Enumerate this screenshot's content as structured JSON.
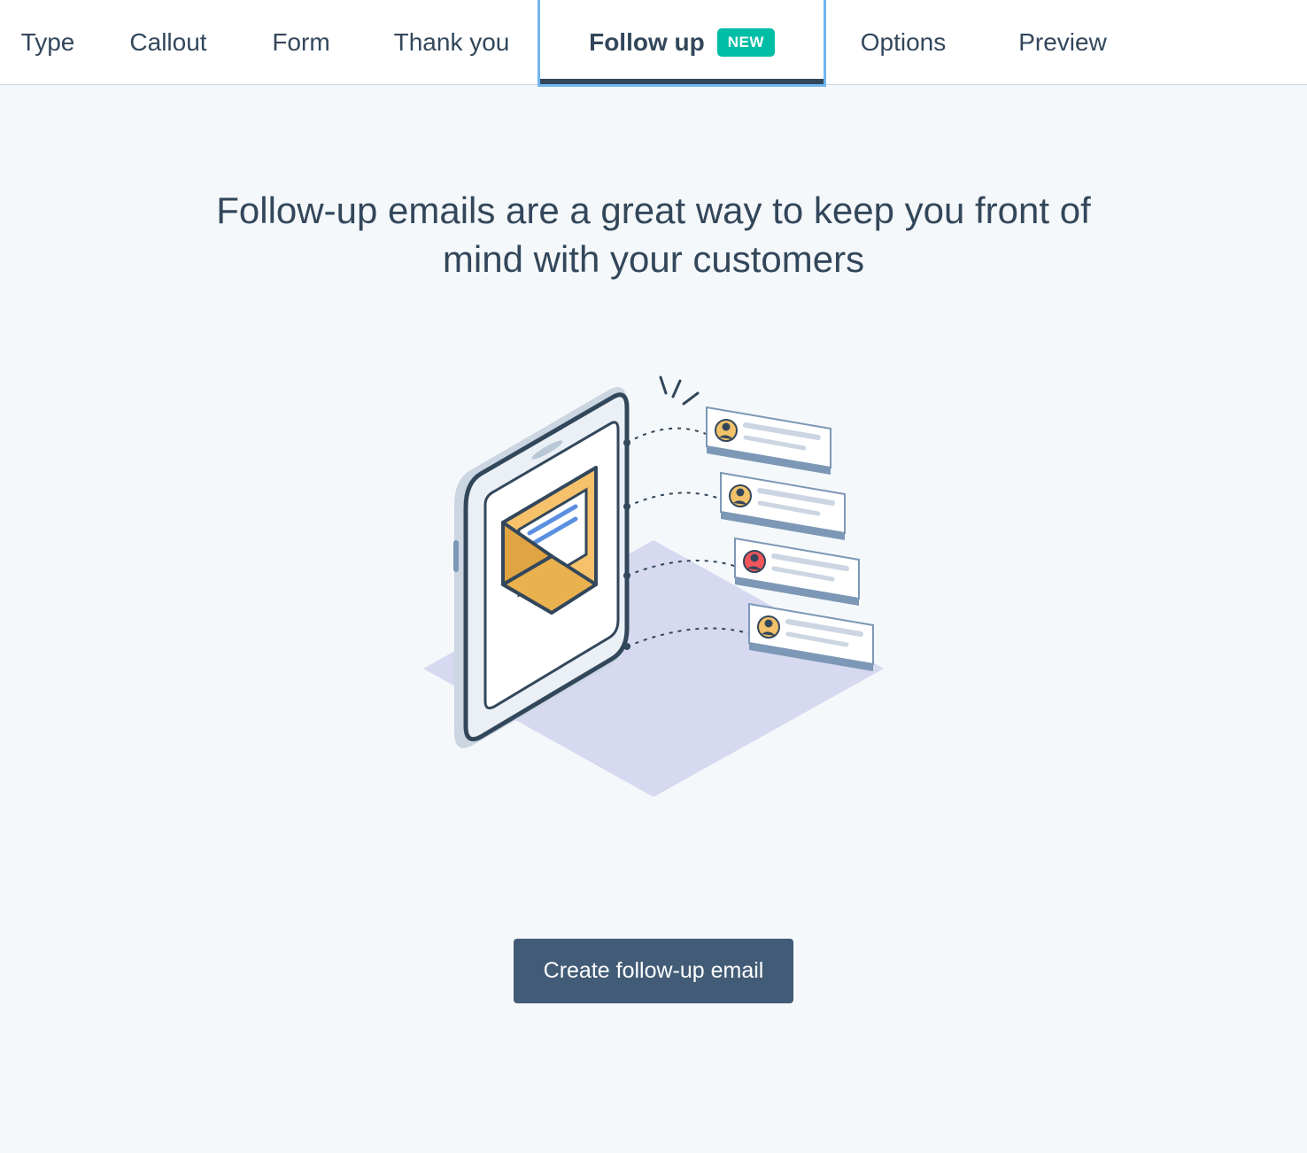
{
  "tabs": [
    {
      "label": "Type"
    },
    {
      "label": "Callout"
    },
    {
      "label": "Form"
    },
    {
      "label": "Thank you"
    },
    {
      "label": "Follow up",
      "badge": "NEW",
      "active": true
    },
    {
      "label": "Options"
    },
    {
      "label": "Preview"
    }
  ],
  "main": {
    "headline": "Follow-up emails are a great way to keep you front of mind with your customers",
    "cta_label": "Create follow-up email"
  }
}
